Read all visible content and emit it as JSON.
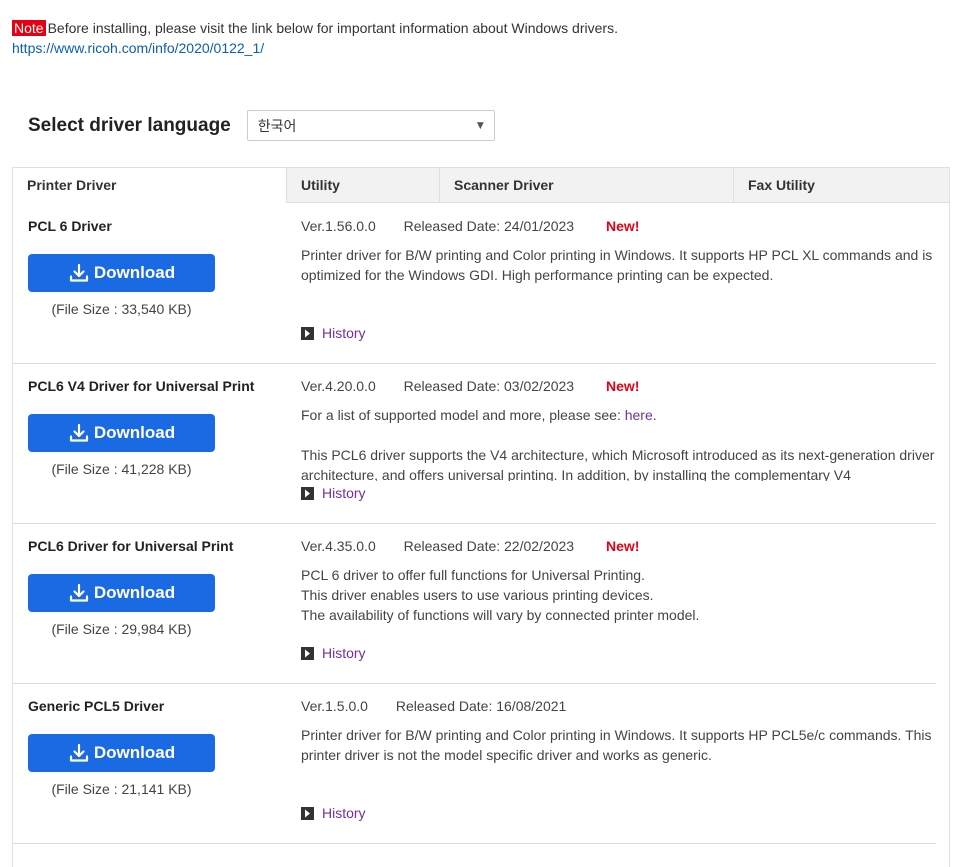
{
  "note": {
    "badge": "Note",
    "text": "Before installing, please visit the link below for important information about Windows drivers.",
    "link": "https://www.ricoh.com/info/2020/0122_1/"
  },
  "language": {
    "label": "Select driver language",
    "selected": "한국어"
  },
  "tabs": [
    {
      "label": "Printer Driver",
      "active": true
    },
    {
      "label": "Utility",
      "active": false
    },
    {
      "label": "Scanner Driver",
      "active": false
    },
    {
      "label": "Fax Utility",
      "active": false
    }
  ],
  "download_label": "Download",
  "history_label": "History",
  "drivers": [
    {
      "name": "PCL 6 Driver",
      "version": "Ver.1.56.0.0",
      "released": "Released Date: 24/01/2023",
      "new_badge": "New!",
      "file_size": "(File Size : 33,540 KB)",
      "description": "Printer driver for B/W printing and Color printing in Windows. It supports HP PCL XL commands and is optimized for the Windows GDI. High performance printing can be expected."
    },
    {
      "name": "PCL6 V4 Driver for Universal Print",
      "version": "Ver.4.20.0.0",
      "released": "Released Date: 03/02/2023",
      "new_badge": "New!",
      "file_size": "(File Size : 41,228 KB)",
      "description_pre": "For a list of supported model and more, please see: ",
      "description_link": "here",
      "description_post": ".",
      "description_2": "This PCL6 driver supports the V4 architecture, which Microsoft introduced as its next-generation driver architecture, and offers universal printing. In addition, by installing the complementary V4"
    },
    {
      "name": "PCL6 Driver for Universal Print",
      "version": "Ver.4.35.0.0",
      "released": "Released Date: 22/02/2023",
      "new_badge": "New!",
      "file_size": "(File Size : 29,984 KB)",
      "lines": [
        "PCL 6 driver to offer full functions for Universal Printing.",
        "This driver enables users to use various printing devices.",
        "The availability of functions will vary by connected printer model."
      ]
    },
    {
      "name": "Generic PCL5 Driver",
      "version": "Ver.1.5.0.0",
      "released": "Released Date: 16/08/2021",
      "new_badge": "",
      "file_size": "(File Size : 21,141 KB)",
      "description": "Printer driver for B/W printing and Color printing in Windows. It supports HP PCL5e/c commands. This printer driver is not the model specific driver and works as generic."
    }
  ]
}
